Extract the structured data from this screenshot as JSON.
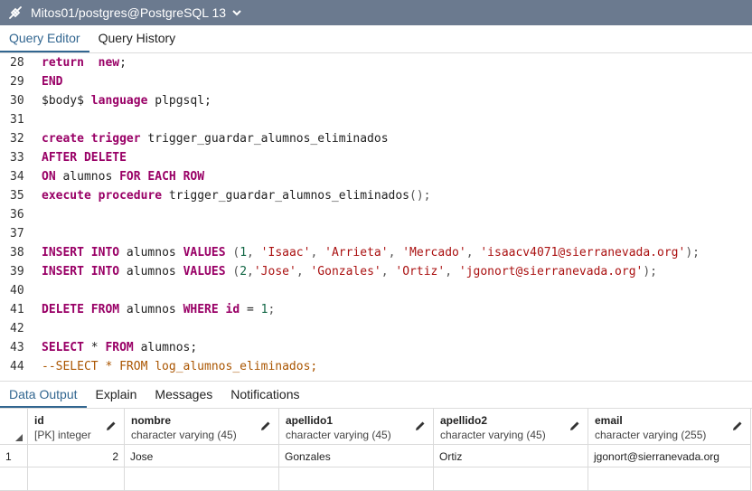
{
  "titlebar": {
    "title": "Mitos01/postgres@PostgreSQL 13",
    "icon": "connection-icon"
  },
  "top_tabs": [
    {
      "label": "Query Editor",
      "active": true
    },
    {
      "label": "Query History",
      "active": false
    }
  ],
  "editor": {
    "lines": [
      {
        "n": "28",
        "tokens": [
          [
            "kw",
            "return"
          ],
          [
            "",
            "  "
          ],
          [
            "kw",
            "new"
          ],
          [
            "",
            "; "
          ]
        ]
      },
      {
        "n": "29",
        "tokens": [
          [
            "kw",
            "END"
          ]
        ]
      },
      {
        "n": "30",
        "tokens": [
          [
            "",
            "$body$ "
          ],
          [
            "kw",
            "language"
          ],
          [
            "",
            " plpgsql;"
          ]
        ]
      },
      {
        "n": "31",
        "tokens": []
      },
      {
        "n": "32",
        "tokens": [
          [
            "kw",
            "create"
          ],
          [
            "",
            " "
          ],
          [
            "kw",
            "trigger"
          ],
          [
            "",
            " trigger_guardar_alumnos_eliminados"
          ]
        ]
      },
      {
        "n": "33",
        "tokens": [
          [
            "kw",
            "AFTER"
          ],
          [
            "",
            " "
          ],
          [
            "kw",
            "DELETE"
          ]
        ]
      },
      {
        "n": "34",
        "tokens": [
          [
            "kw",
            "ON"
          ],
          [
            "",
            " alumnos "
          ],
          [
            "kw",
            "FOR"
          ],
          [
            "",
            " "
          ],
          [
            "kw",
            "EACH"
          ],
          [
            "",
            " "
          ],
          [
            "kw",
            "ROW"
          ]
        ]
      },
      {
        "n": "35",
        "tokens": [
          [
            "kw",
            "execute"
          ],
          [
            "",
            " "
          ],
          [
            "kw",
            "procedure"
          ],
          [
            "",
            " trigger_guardar_alumnos_eliminados"
          ],
          [
            "pn",
            "();"
          ]
        ]
      },
      {
        "n": "36",
        "tokens": []
      },
      {
        "n": "37",
        "tokens": []
      },
      {
        "n": "38",
        "tokens": [
          [
            "kw",
            "INSERT"
          ],
          [
            "",
            " "
          ],
          [
            "kw",
            "INTO"
          ],
          [
            "",
            " alumnos "
          ],
          [
            "kw",
            "VALUES"
          ],
          [
            "",
            " "
          ],
          [
            "pn",
            "("
          ],
          [
            "num",
            "1"
          ],
          [
            "pn",
            ", "
          ],
          [
            "str",
            "'Isaac'"
          ],
          [
            "pn",
            ", "
          ],
          [
            "str",
            "'Arrieta'"
          ],
          [
            "pn",
            ", "
          ],
          [
            "str",
            "'Mercado'"
          ],
          [
            "pn",
            ", "
          ],
          [
            "str",
            "'isaacv4071@sierranevada.org'"
          ],
          [
            "pn",
            ");"
          ]
        ]
      },
      {
        "n": "39",
        "tokens": [
          [
            "kw",
            "INSERT"
          ],
          [
            "",
            " "
          ],
          [
            "kw",
            "INTO"
          ],
          [
            "",
            " alumnos "
          ],
          [
            "kw",
            "VALUES"
          ],
          [
            "",
            " "
          ],
          [
            "pn",
            "("
          ],
          [
            "num",
            "2"
          ],
          [
            "pn",
            ","
          ],
          [
            "str",
            "'Jose'"
          ],
          [
            "pn",
            ", "
          ],
          [
            "str",
            "'Gonzales'"
          ],
          [
            "pn",
            ", "
          ],
          [
            "str",
            "'Ortiz'"
          ],
          [
            "pn",
            ", "
          ],
          [
            "str",
            "'jgonort@sierranevada.org'"
          ],
          [
            "pn",
            ");"
          ]
        ]
      },
      {
        "n": "40",
        "tokens": []
      },
      {
        "n": "41",
        "tokens": [
          [
            "kw",
            "DELETE"
          ],
          [
            "",
            " "
          ],
          [
            "kw",
            "FROM"
          ],
          [
            "",
            " alumnos "
          ],
          [
            "kw",
            "WHERE"
          ],
          [
            "",
            " "
          ],
          [
            "kw",
            "id"
          ],
          [
            "",
            " = "
          ],
          [
            "num",
            "1"
          ],
          [
            "pn",
            ";"
          ]
        ]
      },
      {
        "n": "42",
        "tokens": []
      },
      {
        "n": "43",
        "tokens": [
          [
            "kw",
            "SELECT"
          ],
          [
            "",
            " * "
          ],
          [
            "kw",
            "FROM"
          ],
          [
            "",
            " alumnos;"
          ]
        ]
      },
      {
        "n": "44",
        "tokens": [
          [
            "cm",
            "--SELECT * FROM log_alumnos_eliminados;"
          ]
        ]
      }
    ]
  },
  "bottom_tabs": [
    {
      "label": "Data Output",
      "active": true
    },
    {
      "label": "Explain",
      "active": false
    },
    {
      "label": "Messages",
      "active": false
    },
    {
      "label": "Notifications",
      "active": false
    }
  ],
  "grid": {
    "columns": [
      {
        "name": "id",
        "type": "[PK] integer"
      },
      {
        "name": "nombre",
        "type": "character varying (45)"
      },
      {
        "name": "apellido1",
        "type": "character varying (45)"
      },
      {
        "name": "apellido2",
        "type": "character varying (45)"
      },
      {
        "name": "email",
        "type": "character varying (255)"
      }
    ],
    "rows": [
      {
        "rownum": "1",
        "cells": [
          "2",
          "Jose",
          "Gonzales",
          "Ortiz",
          "jgonort@sierranevada.org"
        ]
      }
    ]
  }
}
